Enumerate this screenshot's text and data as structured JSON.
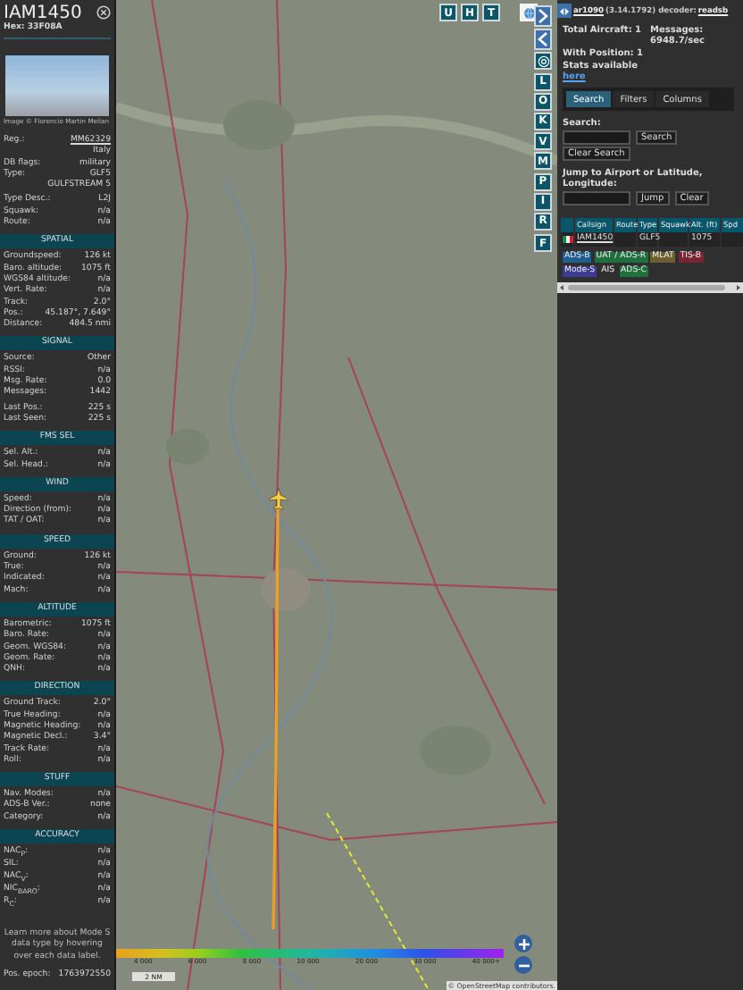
{
  "aircraft_panel": {
    "title": "IAM1450",
    "hex": "Hex: 33F08A",
    "photo_caption": "Image © Florencio Martin Meilan",
    "sections": [
      {
        "groups": [
          [
            {
              "label": "Reg.:",
              "value": "MM62329",
              "link": true
            },
            {
              "value": "Italy"
            },
            {
              "label": "DB flags:",
              "value": "military"
            },
            {
              "label": "Type:",
              "value": "GLF5"
            },
            {
              "value": "GULFSTREAM 5"
            }
          ],
          [
            {
              "label": "Type Desc.:",
              "value": "L2J"
            },
            {
              "label": "Squawk:",
              "value": "n/a"
            },
            {
              "label": "Route:",
              "value": "n/a"
            }
          ]
        ]
      },
      {
        "title": "SPATIAL",
        "groups": [
          [
            {
              "label": "Groundspeed:",
              "value": "126 kt"
            },
            {
              "label": "Baro. altitude:",
              "value": "1075 ft"
            },
            {
              "label": "WGS84 altitude:",
              "value": "n/a"
            },
            {
              "label": "Vert. Rate:",
              "value": "n/a"
            },
            {
              "label": "Track:",
              "value": "2.0°"
            },
            {
              "label": "Pos.:",
              "value": "45.187°, 7.649°"
            },
            {
              "label": "Distance:",
              "value": "484.5 nmi"
            }
          ]
        ]
      },
      {
        "title": "SIGNAL",
        "groups": [
          [
            {
              "label": "Source:",
              "value": "Other"
            },
            {
              "label": "RSSI:",
              "value": "n/a"
            },
            {
              "label": "Msg. Rate:",
              "value": "0.0"
            },
            {
              "label": "Messages:",
              "value": "1442"
            }
          ],
          [
            {
              "label": "Last Pos.:",
              "value": "225 s"
            },
            {
              "label": "Last Seen:",
              "value": "225 s"
            }
          ]
        ]
      },
      {
        "title": "FMS SEL",
        "groups": [
          [
            {
              "label": "Sel. Alt.:",
              "value": "n/a"
            },
            {
              "label": "Sel. Head.:",
              "value": "n/a"
            }
          ]
        ]
      },
      {
        "title": "WIND",
        "groups": [
          [
            {
              "label": "Speed:",
              "value": "n/a"
            },
            {
              "label": "Direction (from):",
              "value": "n/a"
            },
            {
              "label": "TAT / OAT:",
              "value": "n/a"
            }
          ]
        ]
      },
      {
        "title": "SPEED",
        "groups": [
          [
            {
              "label": "Ground:",
              "value": "126 kt"
            },
            {
              "label": "True:",
              "value": "n/a"
            },
            {
              "label": "Indicated:",
              "value": "n/a"
            },
            {
              "label": "Mach:",
              "value": "n/a"
            }
          ]
        ]
      },
      {
        "title": "ALTITUDE",
        "groups": [
          [
            {
              "label": "Barometric:",
              "value": "1075 ft"
            },
            {
              "label": "Baro. Rate:",
              "value": "n/a"
            },
            {
              "label": "Geom. WGS84:",
              "value": "n/a"
            },
            {
              "label": "Geom. Rate:",
              "value": "n/a"
            },
            {
              "label": "QNH:",
              "value": "n/a"
            }
          ]
        ]
      },
      {
        "title": "DIRECTION",
        "groups": [
          [
            {
              "label": "Ground Track:",
              "value": "2.0°"
            },
            {
              "label": "True Heading:",
              "value": "n/a"
            },
            {
              "label": "Magnetic Heading:",
              "value": "n/a"
            },
            {
              "label": "Magnetic Decl.:",
              "value": "3.4°"
            },
            {
              "label": "Track Rate:",
              "value": "n/a"
            },
            {
              "label": "Roll:",
              "value": "n/a"
            }
          ]
        ]
      },
      {
        "title": "STUFF",
        "groups": [
          [
            {
              "label": "Nav. Modes:",
              "value": "n/a"
            },
            {
              "label": "ADS-B Ver.:",
              "value": "none"
            },
            {
              "label": "Category:",
              "value": "n/a"
            }
          ]
        ]
      },
      {
        "title": "ACCURACY",
        "groups": [
          [
            {
              "label": "NAC$_{P}$:",
              "value": "n/a"
            },
            {
              "label": "SIL:",
              "value": "n/a"
            },
            {
              "label": "NAC$_{V}$:",
              "value": "n/a"
            },
            {
              "label": "NIC$_{BARO}$:",
              "value": "n/a"
            },
            {
              "label": "R$_{C}$:",
              "value": "n/a"
            }
          ]
        ]
      }
    ],
    "note": "Learn more about Mode S data type by hovering over each data label.",
    "epoch": {
      "label": "Pos. epoch:",
      "value": "1763972550"
    }
  },
  "map": {
    "top_buttons": [
      "U",
      "H",
      "T"
    ],
    "side_buttons": [
      "L",
      "O",
      "K",
      "V",
      "M",
      "P",
      "I",
      "R",
      "F"
    ],
    "legend": [
      "4 000",
      "6 000",
      "8 000",
      "10 000",
      "20 000",
      "30 000",
      "40 000+"
    ],
    "scale": "2 NM",
    "attribution": "© OpenStreetMap contributors."
  },
  "sidebar": {
    "app": "ar1090",
    "version": "(3.14.1792) decoder:",
    "decoder": "readsb",
    "stats": [
      {
        "label": "Total Aircraft: 1"
      },
      {
        "label": "Messages: 6948.7/sec"
      },
      {
        "label": "With Position: 1"
      }
    ],
    "stats_note": "Stats available",
    "stats_link": "here",
    "tabs": [
      {
        "label": "Search",
        "selected": true
      },
      {
        "label": "Filters",
        "selected": false
      },
      {
        "label": "Columns",
        "selected": false
      }
    ],
    "search_label": "Search:",
    "search_button": "Search",
    "clear_button": "Clear Search",
    "jump_label": "Jump to Airport or Latitude, Longitude:",
    "jump_button": "Jump",
    "jump_clear": "Clear",
    "table": {
      "columns": [
        "Callsign",
        "Route",
        "Type",
        "Squawk",
        "Alt. (ft)",
        "Spd"
      ],
      "rows": [
        {
          "callsign": "IAM1450",
          "type": "GLF5",
          "alt": "1075",
          "selected": false
        }
      ]
    },
    "badges": [
      {
        "label": "ADS-B",
        "color": "#1f5f8f"
      },
      {
        "label": "UAT / ADS-R",
        "color": "#1f6f3f"
      },
      {
        "label": "MLAT",
        "color": "#6f5f2f"
      },
      {
        "label": "TIS-B",
        "color": "#7a2535"
      },
      {
        "label": "Mode-S",
        "color": "#3b3b8f"
      },
      {
        "label": "AIS",
        "color": "#303030"
      },
      {
        "label": "ADS-C",
        "color": "#1f6f3f"
      }
    ]
  }
}
